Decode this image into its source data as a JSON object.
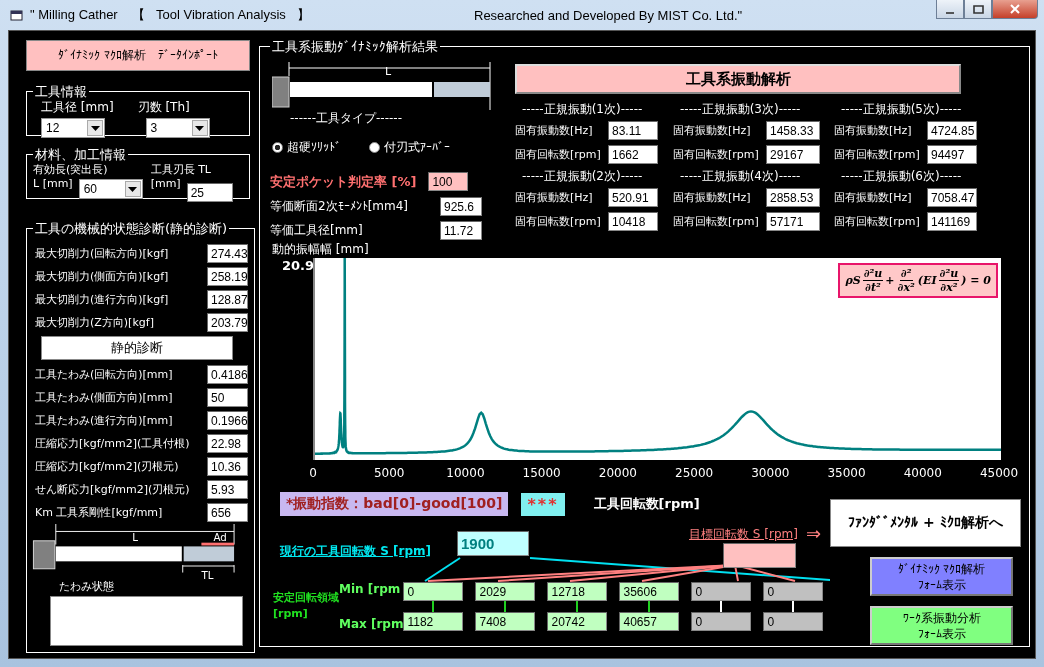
{
  "window": {
    "title_left": "\" Milling Cather    【   Tool Vibration Analysis   】",
    "title_right": "Researched and Developed By MIST Co. Ltd.\""
  },
  "import_button": "ﾀﾞｲﾅﾐｯｸ ﾏｸﾛ解析　ﾃﾞｰﾀｲﾝﾎﾟｰﾄ",
  "tool_info": {
    "title": "工具情報",
    "fields": [
      {
        "label": "工具径 [mm]",
        "value": "12"
      },
      {
        "label": "刃数 [Th]",
        "value": "3"
      }
    ]
  },
  "material_info": {
    "title": "材料、加工情報",
    "fields": [
      {
        "kind": "combo",
        "label": "有効長(突出長)",
        "unit": "L [mm]",
        "value": "60"
      },
      {
        "kind": "text",
        "label": "工具刃長 TL",
        "unit": "[mm]",
        "value": "25"
      }
    ]
  },
  "diagnosis": {
    "title": "工具の機械的状態診断(静的診断)",
    "forces": [
      {
        "label": "最大切削力(回転方向)[kgf]",
        "value": "274.43"
      },
      {
        "label": "最大切削力(側面方向)[kgf]",
        "value": "258.19"
      },
      {
        "label": "最大切削力(進行方向)[kgf]",
        "value": "128.87"
      },
      {
        "label": "最大切削力(Z方向)[kgf]",
        "value": "203.79"
      }
    ],
    "button": "静的診断",
    "results": [
      {
        "label": "工具たわみ(回転方向)[mm]",
        "value": "0.4186"
      },
      {
        "label": "工具たわみ(側面方向)[mm]",
        "value": "50"
      },
      {
        "label": "工具たわみ(進行方向)[mm]",
        "value": "0.1966"
      },
      {
        "label": "圧縮応力[kgf/mm2](工具付根)",
        "value": "22.98"
      },
      {
        "label": "圧縮応力[kgf/mm2](刃根元)",
        "value": "10.36"
      },
      {
        "label": "せん断応力[kgf/mm2](刃根元)",
        "value": "5.93"
      },
      {
        "label": "Km 工具系剛性[kgf/mm]",
        "value": "656"
      }
    ],
    "diagram": {
      "length_label": "L",
      "ad_label": "Ad",
      "tl_label": "TL"
    },
    "deflection_label": "たわみ状態"
  },
  "analysis": {
    "title": "工具系振動ﾀﾞｲﾅﾐｯｸ解析結果",
    "tool_type": {
      "length_label": "L",
      "caption": "------工具タイプ------"
    },
    "tool_kinds": [
      {
        "label": "超硬ｿﾘｯﾄﾞ",
        "selected": true
      },
      {
        "label": "付刃式ｱｰﾊﾞｰ",
        "selected": false
      }
    ],
    "stability": {
      "label": "安定ポケット判定率 [%]",
      "value": "100"
    },
    "properties": [
      {
        "label": "等価断面2次ﾓｰﾒﾝﾄ[mm4]",
        "value": "925.6"
      },
      {
        "label": "等価工具径[mm]",
        "value": "11.72"
      }
    ],
    "analyze_button": "工具系振動解析",
    "modes": [
      {
        "title": "-----正規振動(1次)-----",
        "freq_label": "固有振動数[Hz]",
        "freq": "83.11",
        "rpm_label": "固有回転数[rpm]",
        "rpm": "1662"
      },
      {
        "title": "-----正規振動(3次)-----",
        "freq_label": "固有振動数[Hz]",
        "freq": "1458.33",
        "rpm_label": "固有回転数[rpm]",
        "rpm": "29167"
      },
      {
        "title": "-----正規振動(5次)-----",
        "freq_label": "固有振動数[Hz]",
        "freq": "4724.85",
        "rpm_label": "固有回転数[rpm]",
        "rpm": "94497"
      },
      {
        "title": "-----正規振動(2次)-----",
        "freq_label": "固有振動数[Hz]",
        "freq": "520.91",
        "rpm_label": "固有回転数[rpm]",
        "rpm": "10418"
      },
      {
        "title": "-----正規振動(4次)-----",
        "freq_label": "固有振動数[Hz]",
        "freq": "2858.53",
        "rpm_label": "固有回転数[rpm]",
        "rpm": "57171"
      },
      {
        "title": "-----正規振動(6次)-----",
        "freq_label": "固有振動数[Hz]",
        "freq": "7058.47",
        "rpm_label": "固有回転数[rpm]",
        "rpm": "141169"
      }
    ],
    "chart": {
      "ylabel": "動的振幅幅 [mm]",
      "y_max_label": "20.9",
      "x_tick_labels": [
        "0",
        "5000",
        "10000",
        "15000",
        "20000",
        "25000",
        "30000",
        "35000",
        "40000",
        "45000"
      ],
      "formula": [
        {
          "kind": "text",
          "text": "ρS"
        },
        {
          "kind": "frac",
          "num": "∂²u",
          "den": "∂t²"
        },
        {
          "kind": "text",
          "text": "+"
        },
        {
          "kind": "frac",
          "num": "∂²",
          "den": "∂x²"
        },
        {
          "kind": "text",
          "text": "(EI"
        },
        {
          "kind": "frac",
          "num": "∂²u",
          "den": "∂x²"
        },
        {
          "kind": "text",
          "text": ") = 0"
        }
      ]
    },
    "index": {
      "label": "*振動指数：bad[0]-good[100]",
      "value": "***"
    },
    "rpm_axis_label": "工具回転数[rpm]",
    "current_rpm": {
      "label": "現行の工具回転数 S [rpm]",
      "value": "1900"
    },
    "target_rpm": {
      "label": "目標回転数 S [rpm]"
    },
    "arrow": "⇒",
    "fundamental_button": "ﾌｧﾝﾀﾞﾞﾒﾝﾀﾙ + ﾐｸﾛ解析へ",
    "stable_range": {
      "label": [
        "安定回転領域",
        "[rpm]"
      ],
      "min_label": "Min [rpm",
      "max_label": "Max [rpm",
      "ranges": [
        {
          "min": "0",
          "max": "1182",
          "disabled": false
        },
        {
          "min": "2029",
          "max": "7408",
          "disabled": false
        },
        {
          "min": "12718",
          "max": "20742",
          "disabled": false
        },
        {
          "min": "35606",
          "max": "40657",
          "disabled": false
        },
        {
          "min": "0",
          "max": "0",
          "disabled": true
        },
        {
          "min": "0",
          "max": "0",
          "disabled": true
        }
      ]
    },
    "form_buttons": [
      {
        "lines": [
          "ﾀﾞｲﾅﾐｯｸ ﾏｸﾛ解析",
          "ﾌｫｰﾑ表示"
        ],
        "color": "#8080ff"
      },
      {
        "lines": [
          "ﾜｰｸ系振動分析",
          "ﾌｫｰﾑ表示"
        ],
        "color": "#80ff80"
      }
    ]
  }
}
